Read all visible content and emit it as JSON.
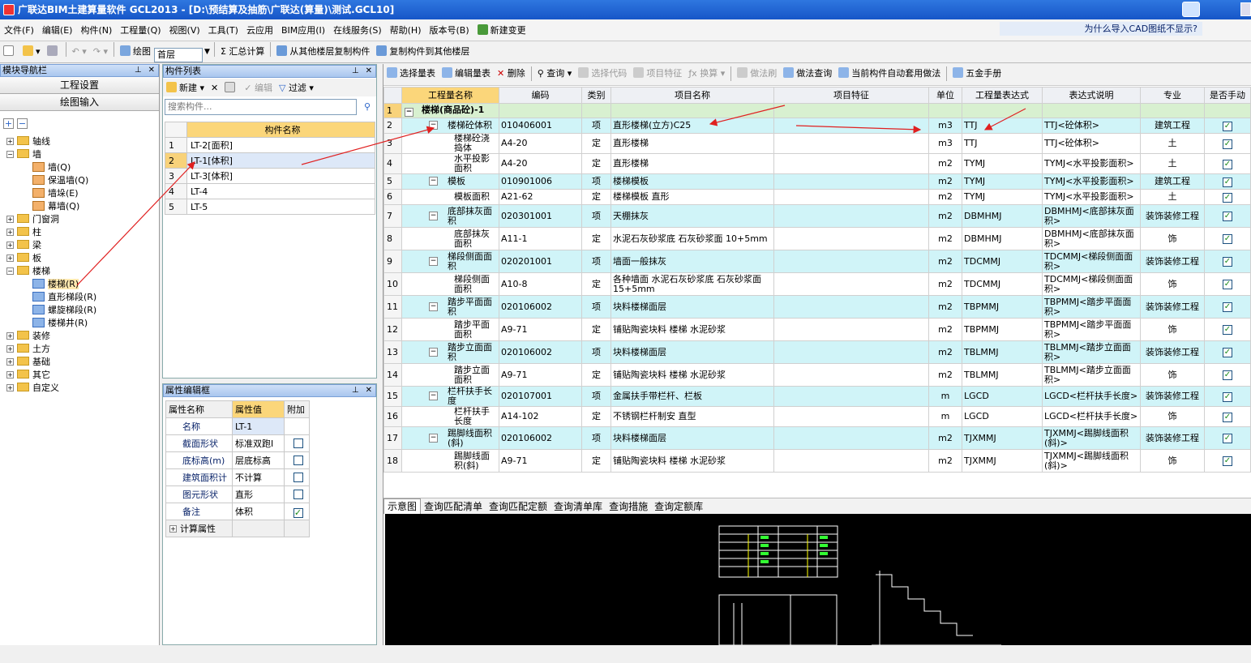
{
  "window": {
    "title": "广联达BIM土建算量软件 GCL2013 - [D:\\预结算及抽筋\\广联达(算量)\\测试.GCL10]"
  },
  "menu": [
    "文件(F)",
    "编辑(E)",
    "构件(N)",
    "工程量(Q)",
    "视图(V)",
    "工具(T)",
    "云应用",
    "BIM应用(I)",
    "在线服务(S)",
    "帮助(H)",
    "版本号(B)",
    "新建变更"
  ],
  "cad_question": "为什么导入CAD图纸不显示?",
  "toolbar": {
    "draw": "绘图",
    "floor": "首层",
    "summary": "Σ 汇总计算",
    "copy_from": "从其他楼层复制构件",
    "copy_to": "复制构件到其他楼层"
  },
  "nav": {
    "title": "模块导航栏",
    "btn_project": "工程设置",
    "btn_draw": "绘图输入",
    "tree": [
      {
        "label": "轴线",
        "level": 0,
        "type": "folder",
        "pm": "+"
      },
      {
        "label": "墙",
        "level": 0,
        "type": "folder",
        "pm": "-"
      },
      {
        "label": "墙(Q)",
        "level": 1,
        "type": "leaf"
      },
      {
        "label": "保温墙(Q)",
        "level": 1,
        "type": "leaf"
      },
      {
        "label": "墙垛(E)",
        "level": 1,
        "type": "leaf"
      },
      {
        "label": "幕墙(Q)",
        "level": 1,
        "type": "leaf"
      },
      {
        "label": "门窗洞",
        "level": 0,
        "type": "folder",
        "pm": "+"
      },
      {
        "label": "柱",
        "level": 0,
        "type": "folder",
        "pm": "+"
      },
      {
        "label": "梁",
        "level": 0,
        "type": "folder",
        "pm": "+"
      },
      {
        "label": "板",
        "level": 0,
        "type": "folder",
        "pm": "+"
      },
      {
        "label": "楼梯",
        "level": 0,
        "type": "folder",
        "pm": "-"
      },
      {
        "label": "楼梯(R)",
        "level": 1,
        "type": "leafb"
      },
      {
        "label": "直形梯段(R)",
        "level": 1,
        "type": "leafb"
      },
      {
        "label": "螺旋梯段(R)",
        "level": 1,
        "type": "leafb"
      },
      {
        "label": "楼梯井(R)",
        "level": 1,
        "type": "leafb"
      },
      {
        "label": "装修",
        "level": 0,
        "type": "folder",
        "pm": "+"
      },
      {
        "label": "土方",
        "level": 0,
        "type": "folder",
        "pm": "+"
      },
      {
        "label": "基础",
        "level": 0,
        "type": "folder",
        "pm": "+"
      },
      {
        "label": "其它",
        "level": 0,
        "type": "folder",
        "pm": "+"
      },
      {
        "label": "自定义",
        "level": 0,
        "type": "folder",
        "pm": "+"
      }
    ]
  },
  "complist": {
    "title": "构件列表",
    "btn_new": "新建",
    "btn_edit": "编辑",
    "btn_filter": "过滤",
    "search_placeholder": "搜索构件...",
    "col_name": "构件名称",
    "rows": [
      {
        "n": "1",
        "name": "LT-2[面积]"
      },
      {
        "n": "2",
        "name": "LT-1[体积]"
      },
      {
        "n": "3",
        "name": "LT-3[体积]"
      },
      {
        "n": "4",
        "name": "LT-4"
      },
      {
        "n": "5",
        "name": "LT-5"
      }
    ]
  },
  "props": {
    "title": "属性编辑框",
    "h_name": "属性名称",
    "h_value": "属性值",
    "h_extra": "附加",
    "rows": [
      {
        "k": "名称",
        "v": "LT-1",
        "cb": ""
      },
      {
        "k": "截面形状",
        "v": "标准双跑I",
        "cb": "off"
      },
      {
        "k": "底标高(m)",
        "v": "层底标高",
        "cb": "off"
      },
      {
        "k": "建筑面积计",
        "v": "不计算",
        "cb": "off"
      },
      {
        "k": "图元形状",
        "v": "直形",
        "cb": "off"
      },
      {
        "k": "备注",
        "v": "体积",
        "cb": "on"
      }
    ],
    "calc": "计算属性"
  },
  "main_toolbar": [
    "选择量表",
    "编辑量表",
    "删除",
    "查询",
    "选择代码",
    "项目特征",
    "换算",
    "做法刷",
    "做法查询",
    "当前构件自动套用做法",
    "五金手册"
  ],
  "grid": {
    "headers": [
      "工程量名称",
      "编码",
      "类别",
      "项目名称",
      "项目特征",
      "单位",
      "工程量表达式",
      "表达式说明",
      "专业",
      "是否手动"
    ],
    "rows": [
      {
        "n": "1",
        "kind": "lvl1",
        "name": "楼梯(商品砼)-1",
        "code": "",
        "cat": "",
        "item": "",
        "feat": "",
        "unit": "",
        "expr": "",
        "desc": "",
        "major": "",
        "chk": false
      },
      {
        "n": "2",
        "kind": "q",
        "name": "楼梯砼体积",
        "code": "010406001",
        "cat": "项",
        "item": "直形楼梯(立方)C25",
        "feat": "",
        "unit": "m3",
        "expr": "TTJ",
        "desc": "TTJ<砼体积>",
        "major": "建筑工程",
        "chk": true
      },
      {
        "n": "3",
        "kind": "s",
        "name": "楼梯砼浇捣体",
        "code": "A4-20",
        "cat": "定",
        "item": "直形楼梯",
        "feat": "",
        "unit": "m3",
        "expr": "TTJ",
        "desc": "TTJ<砼体积>",
        "major": "土",
        "chk": true
      },
      {
        "n": "4",
        "kind": "s",
        "name": "水平投影面积",
        "code": "A4-20",
        "cat": "定",
        "item": "直形楼梯",
        "feat": "",
        "unit": "m2",
        "expr": "TYMJ",
        "desc": "TYMJ<水平投影面积>",
        "major": "土",
        "chk": true
      },
      {
        "n": "5",
        "kind": "q",
        "name": "模板",
        "code": "010901006",
        "cat": "项",
        "item": "楼梯模板",
        "feat": "",
        "unit": "m2",
        "expr": "TYMJ",
        "desc": "TYMJ<水平投影面积>",
        "major": "建筑工程",
        "chk": true
      },
      {
        "n": "6",
        "kind": "s",
        "name": "模板面积",
        "code": "A21-62",
        "cat": "定",
        "item": "楼梯模板 直形",
        "feat": "",
        "unit": "m2",
        "expr": "TYMJ",
        "desc": "TYMJ<水平投影面积>",
        "major": "土",
        "chk": true
      },
      {
        "n": "7",
        "kind": "q",
        "name": "底部抹灰面积",
        "code": "020301001",
        "cat": "项",
        "item": "天棚抹灰",
        "feat": "",
        "unit": "m2",
        "expr": "DBMHMJ",
        "desc": "DBMHMJ<底部抹灰面积>",
        "major": "装饰装修工程",
        "chk": true
      },
      {
        "n": "8",
        "kind": "s",
        "name": "底部抹灰面积",
        "code": "A11-1",
        "cat": "定",
        "item": "水泥石灰砂浆底 石灰砂浆面 10+5mm",
        "feat": "",
        "unit": "m2",
        "expr": "DBMHMJ",
        "desc": "DBMHMJ<底部抹灰面积>",
        "major": "饰",
        "chk": true
      },
      {
        "n": "9",
        "kind": "q",
        "name": "梯段侧面面积",
        "code": "020201001",
        "cat": "项",
        "item": "墙面一般抹灰",
        "feat": "",
        "unit": "m2",
        "expr": "TDCMMJ",
        "desc": "TDCMMJ<梯段侧面面积>",
        "major": "装饰装修工程",
        "chk": true
      },
      {
        "n": "10",
        "kind": "s",
        "name": "梯段侧面面积",
        "code": "A10-8",
        "cat": "定",
        "item": "各种墙面 水泥石灰砂浆底 石灰砂浆面 15+5mm",
        "feat": "",
        "unit": "m2",
        "expr": "TDCMMJ",
        "desc": "TDCMMJ<梯段侧面面积>",
        "major": "饰",
        "chk": true
      },
      {
        "n": "11",
        "kind": "q",
        "name": "踏步平面面积",
        "code": "020106002",
        "cat": "项",
        "item": "块料楼梯面层",
        "feat": "",
        "unit": "m2",
        "expr": "TBPMMJ",
        "desc": "TBPMMJ<踏步平面面积>",
        "major": "装饰装修工程",
        "chk": true
      },
      {
        "n": "12",
        "kind": "s",
        "name": "踏步平面面积",
        "code": "A9-71",
        "cat": "定",
        "item": "铺贴陶瓷块料 楼梯 水泥砂浆",
        "feat": "",
        "unit": "m2",
        "expr": "TBPMMJ",
        "desc": "TBPMMJ<踏步平面面积>",
        "major": "饰",
        "chk": true
      },
      {
        "n": "13",
        "kind": "q",
        "name": "踏步立面面积",
        "code": "020106002",
        "cat": "项",
        "item": "块料楼梯面层",
        "feat": "",
        "unit": "m2",
        "expr": "TBLMMJ",
        "desc": "TBLMMJ<踏步立面面积>",
        "major": "装饰装修工程",
        "chk": true
      },
      {
        "n": "14",
        "kind": "s",
        "name": "踏步立面面积",
        "code": "A9-71",
        "cat": "定",
        "item": "铺贴陶瓷块料 楼梯 水泥砂浆",
        "feat": "",
        "unit": "m2",
        "expr": "TBLMMJ",
        "desc": "TBLMMJ<踏步立面面积>",
        "major": "饰",
        "chk": true
      },
      {
        "n": "15",
        "kind": "q",
        "name": "栏杆扶手长度",
        "code": "020107001",
        "cat": "项",
        "item": "金属扶手带栏杆、栏板",
        "feat": "",
        "unit": "m",
        "expr": "LGCD",
        "desc": "LGCD<栏杆扶手长度>",
        "major": "装饰装修工程",
        "chk": true
      },
      {
        "n": "16",
        "kind": "s",
        "name": "栏杆扶手长度",
        "code": "A14-102",
        "cat": "定",
        "item": "不锈钢栏杆制安 直型",
        "feat": "",
        "unit": "m",
        "expr": "LGCD",
        "desc": "LGCD<栏杆扶手长度>",
        "major": "饰",
        "chk": true
      },
      {
        "n": "17",
        "kind": "q",
        "name": "踢脚线面积(斜)",
        "code": "020106002",
        "cat": "项",
        "item": "块料楼梯面层",
        "feat": "",
        "unit": "m2",
        "expr": "TJXMMJ",
        "desc": "TJXMMJ<踢脚线面积(斜)>",
        "major": "装饰装修工程",
        "chk": true
      },
      {
        "n": "18",
        "kind": "s",
        "name": "踢脚线面积(斜)",
        "code": "A9-71",
        "cat": "定",
        "item": "铺贴陶瓷块料 楼梯 水泥砂浆",
        "feat": "",
        "unit": "m2",
        "expr": "TJXMMJ",
        "desc": "TJXMMJ<踢脚线面积(斜)>",
        "major": "饰",
        "chk": true
      }
    ]
  },
  "bottom_tabs": [
    "示意图",
    "查询匹配清单",
    "查询匹配定额",
    "查询清单库",
    "查询措施",
    "查询定额库"
  ],
  "colors": {
    "header_highlight": "#fbd67a",
    "quota_row": "#d0f4f8",
    "level1_row": "#d8f0d0",
    "arrow": "#e02020"
  }
}
